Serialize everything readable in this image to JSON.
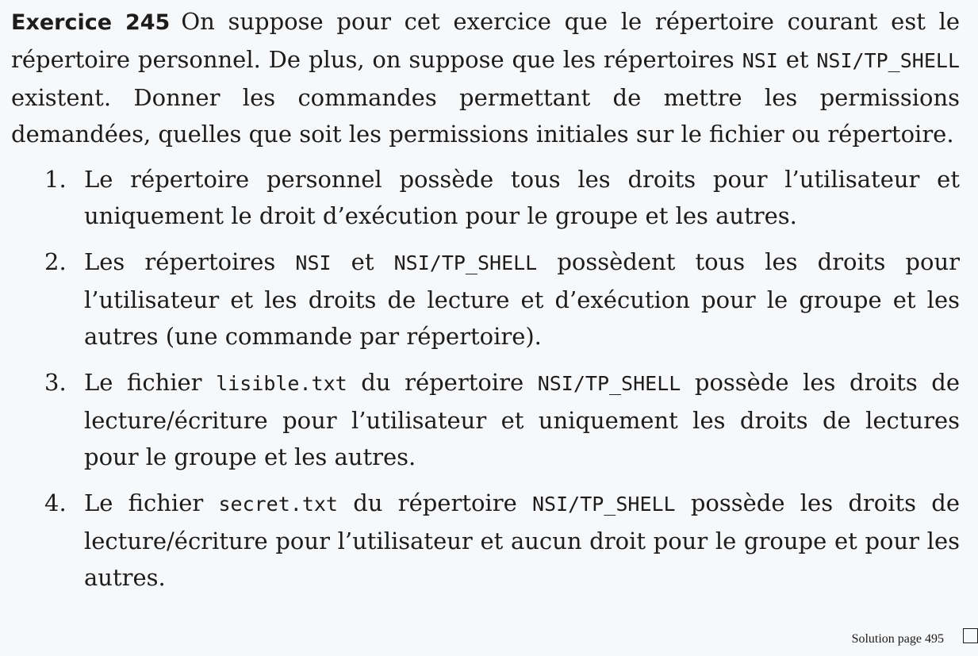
{
  "exercise": {
    "label": "Exercice 245",
    "intro": [
      {
        "t": "On suppose pour cet exercice que le répertoire courant est le répertoire personnel. De plus, on suppose que les répertoires "
      },
      {
        "t": "NSI",
        "m": true
      },
      {
        "t": " et "
      },
      {
        "t": "NSI/TP_SHELL",
        "m": true
      },
      {
        "t": " existent. Donner les commandes permettant de mettre les permissions demandées, quelles que soit les permissions initiales sur le fi­chier ou répertoire."
      }
    ],
    "items": [
      {
        "number": "1.",
        "parts": [
          {
            "t": "Le répertoire personnel possède tous les droits pour l’utilisateur et uniquement le droit d’exécution pour le groupe et les autres."
          }
        ]
      },
      {
        "number": "2.",
        "parts": [
          {
            "t": "Les répertoires "
          },
          {
            "t": "NSI",
            "m": true
          },
          {
            "t": " et "
          },
          {
            "t": "NSI/TP_SHELL",
            "m": true
          },
          {
            "t": " possèdent tous les droits pour l’utilisateur et les droits de lecture et d’exécution pour le groupe et les autres (une commande par répertoire)."
          }
        ]
      },
      {
        "number": "3.",
        "parts": [
          {
            "t": "Le fichier "
          },
          {
            "t": "lisible.txt",
            "m": true
          },
          {
            "t": " du répertoire "
          },
          {
            "t": "NSI/TP_SHELL",
            "m": true
          },
          {
            "t": " possède les droits de lecture/écriture pour l’utilisateur et uniquement les droits de lec­tures pour le groupe et les autres."
          }
        ]
      },
      {
        "number": "4.",
        "parts": [
          {
            "t": "Le fichier "
          },
          {
            "t": "secret.txt",
            "m": true
          },
          {
            "t": " du répertoire "
          },
          {
            "t": "NSI/TP_SHELL",
            "m": true
          },
          {
            "t": " possède les droits de lecture/écriture pour l’utilisateur et aucun droit pour le groupe et pour les autres."
          }
        ]
      }
    ],
    "solution": "Solution page 495"
  }
}
